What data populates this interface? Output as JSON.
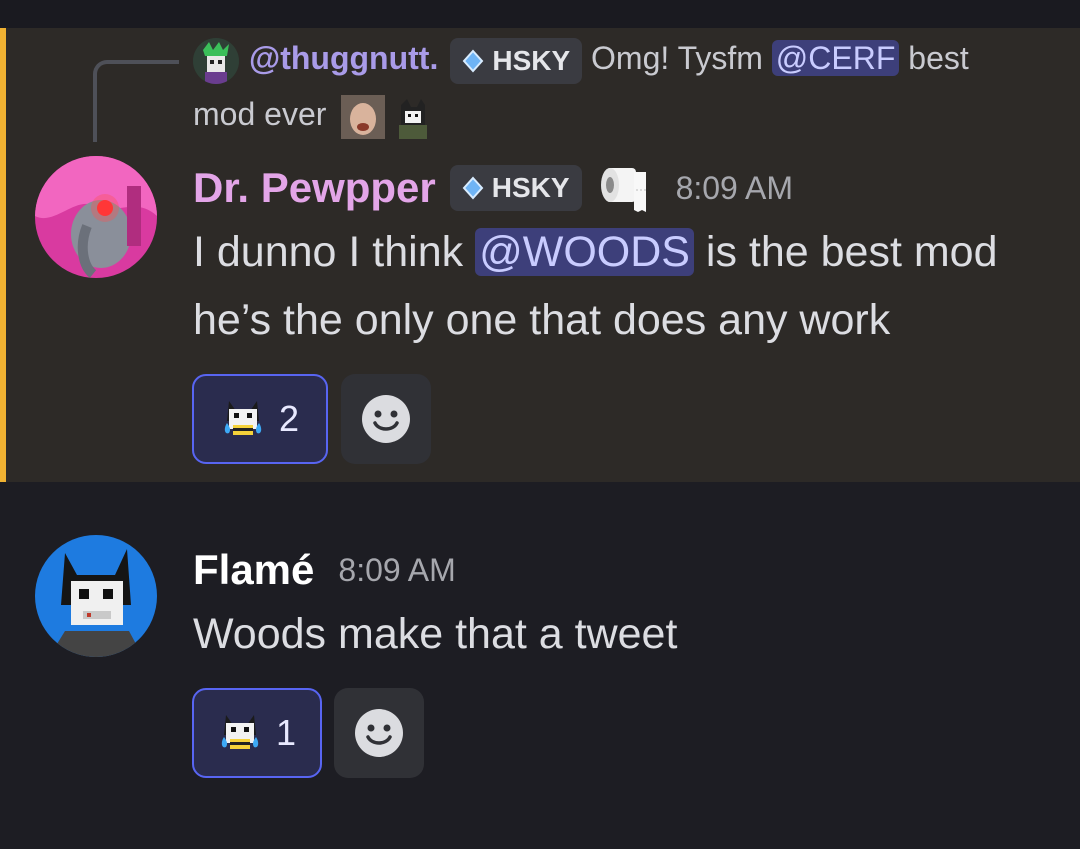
{
  "reply": {
    "author": "@thuggnutt.",
    "tag": "HSKY",
    "text_before": "Omg! Tysfm",
    "mention": "@CERF",
    "text_after": "best",
    "text_line2": "mod ever"
  },
  "messages": [
    {
      "author": "Dr. Pewpper",
      "author_color": "#e3a5e8",
      "tag": "HSKY",
      "timestamp": "8:09 AM",
      "line1_before": "I dunno I think",
      "mention": "@WOODS",
      "line1_after": "is the best mod",
      "line2": "he’s the only one that does any work",
      "reaction_count": "2"
    },
    {
      "author": "Flamé",
      "author_color": "#ffffff",
      "timestamp": "8:09 AM",
      "text": "Woods make that a tweet",
      "reaction_count": "1"
    }
  ],
  "colors": {
    "highlight_bg": "#2d2a27",
    "highlight_bar": "#f0b232",
    "mention_bg": "#3d3f7a",
    "reaction_border": "#5865f2"
  },
  "icons": {
    "tag": "blue-droplet-icon",
    "toilet_paper": "toilet-paper-icon",
    "reaction_emoji": "crying-husky-emoji-icon",
    "add_reaction": "smiley-face-icon"
  }
}
